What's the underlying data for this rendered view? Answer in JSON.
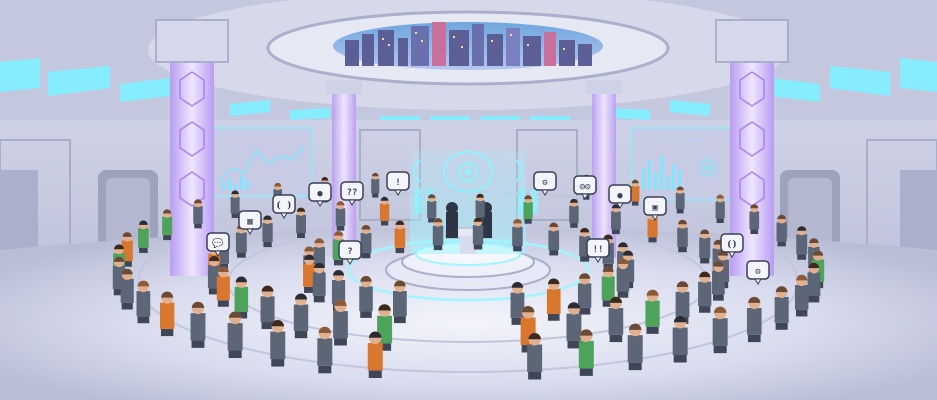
{
  "scene": {
    "colors": {
      "wall": "#d7d9ea",
      "wall_dark": "#a9aec8",
      "floor": "#dcdff0",
      "floor_line": "#b9bdd6",
      "pillar_glow": "#cdb6ff",
      "pillar_core": "#e9dcff",
      "ceiling_light": "#7fe9ff",
      "hologram": "#8ff3ff",
      "uniform": "#5d6677",
      "uniform_dark": "#3f4658",
      "skin": "#e2b08f",
      "hair": "#6b4a35",
      "accent_orange": "#d9772f",
      "accent_green": "#4ea35a",
      "bubble": "#f4f5fb"
    },
    "wall_screens": [
      {
        "id": "left",
        "caption": ""
      },
      {
        "id": "right",
        "caption": "— — — — —— —— — ——— ——"
      }
    ],
    "bubbles": [
      {
        "id": "b1",
        "text": "💬",
        "kind": "chat"
      },
      {
        "id": "b2",
        "text": "▦",
        "kind": "chart"
      },
      {
        "id": "b3",
        "text": "⦗ ⦘",
        "kind": "brackets"
      },
      {
        "id": "b4",
        "text": "●",
        "kind": "green"
      },
      {
        "id": "b5",
        "text": "??",
        "kind": "question"
      },
      {
        "id": "b6",
        "text": "!",
        "kind": "exclaim"
      },
      {
        "id": "b7",
        "text": "?",
        "kind": "question"
      },
      {
        "id": "b8",
        "text": "⚙",
        "kind": "gear"
      },
      {
        "id": "b9",
        "text": "◎◎",
        "kind": "eyes"
      },
      {
        "id": "b10",
        "text": "●",
        "kind": "green"
      },
      {
        "id": "b11",
        "text": "▣",
        "kind": "screen"
      },
      {
        "id": "b12",
        "text": "!!",
        "kind": "exclaim"
      },
      {
        "id": "b13",
        "text": "⦗⦘",
        "kind": "brackets"
      },
      {
        "id": "b14",
        "text": "⚙",
        "kind": "gear"
      }
    ]
  }
}
